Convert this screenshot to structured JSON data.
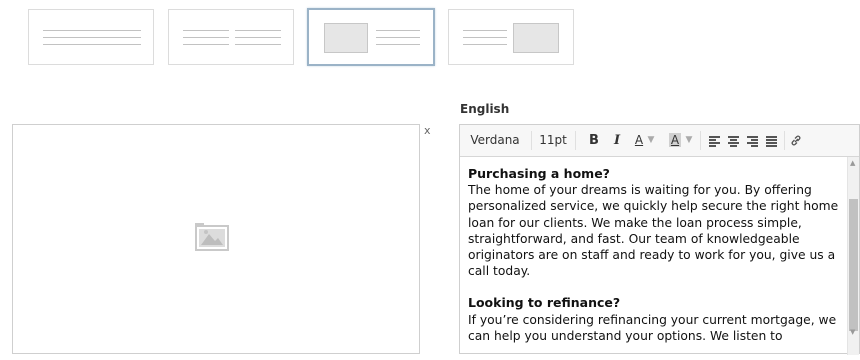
{
  "layout_options": [
    {
      "name": "text-only",
      "selected": false
    },
    {
      "name": "two-columns",
      "selected": false
    },
    {
      "name": "image-left",
      "selected": true
    },
    {
      "name": "image-right",
      "selected": false
    }
  ],
  "image_panel": {
    "close_label": "x",
    "icon": "image-placeholder-icon"
  },
  "editor": {
    "language_label": "English",
    "toolbar": {
      "font_family": "Verdana",
      "font_size": "11pt",
      "bold": "B",
      "italic": "I",
      "text_color": "A",
      "highlight": "A",
      "dropdown_arrow": "▼",
      "link_icon": "link-icon"
    },
    "content": {
      "heading1": "Purchasing a home?",
      "para1": "The home of your dreams is waiting for you. By offering personalized service, we quickly help secure the right home loan for our clients. We make the loan process simple, straightforward, and fast. Our team of knowledgeable originators are on staff and ready to work for you, give us a call today.",
      "heading2": "Looking to refinance?",
      "para2": "If you’re considering refinancing your current mortgage, we can help you understand your options. We listen to"
    }
  },
  "colors": {
    "selected_border": "#9bb3c7",
    "border": "#cfcfcf",
    "toolbar_bg": "#f7f7f7"
  }
}
